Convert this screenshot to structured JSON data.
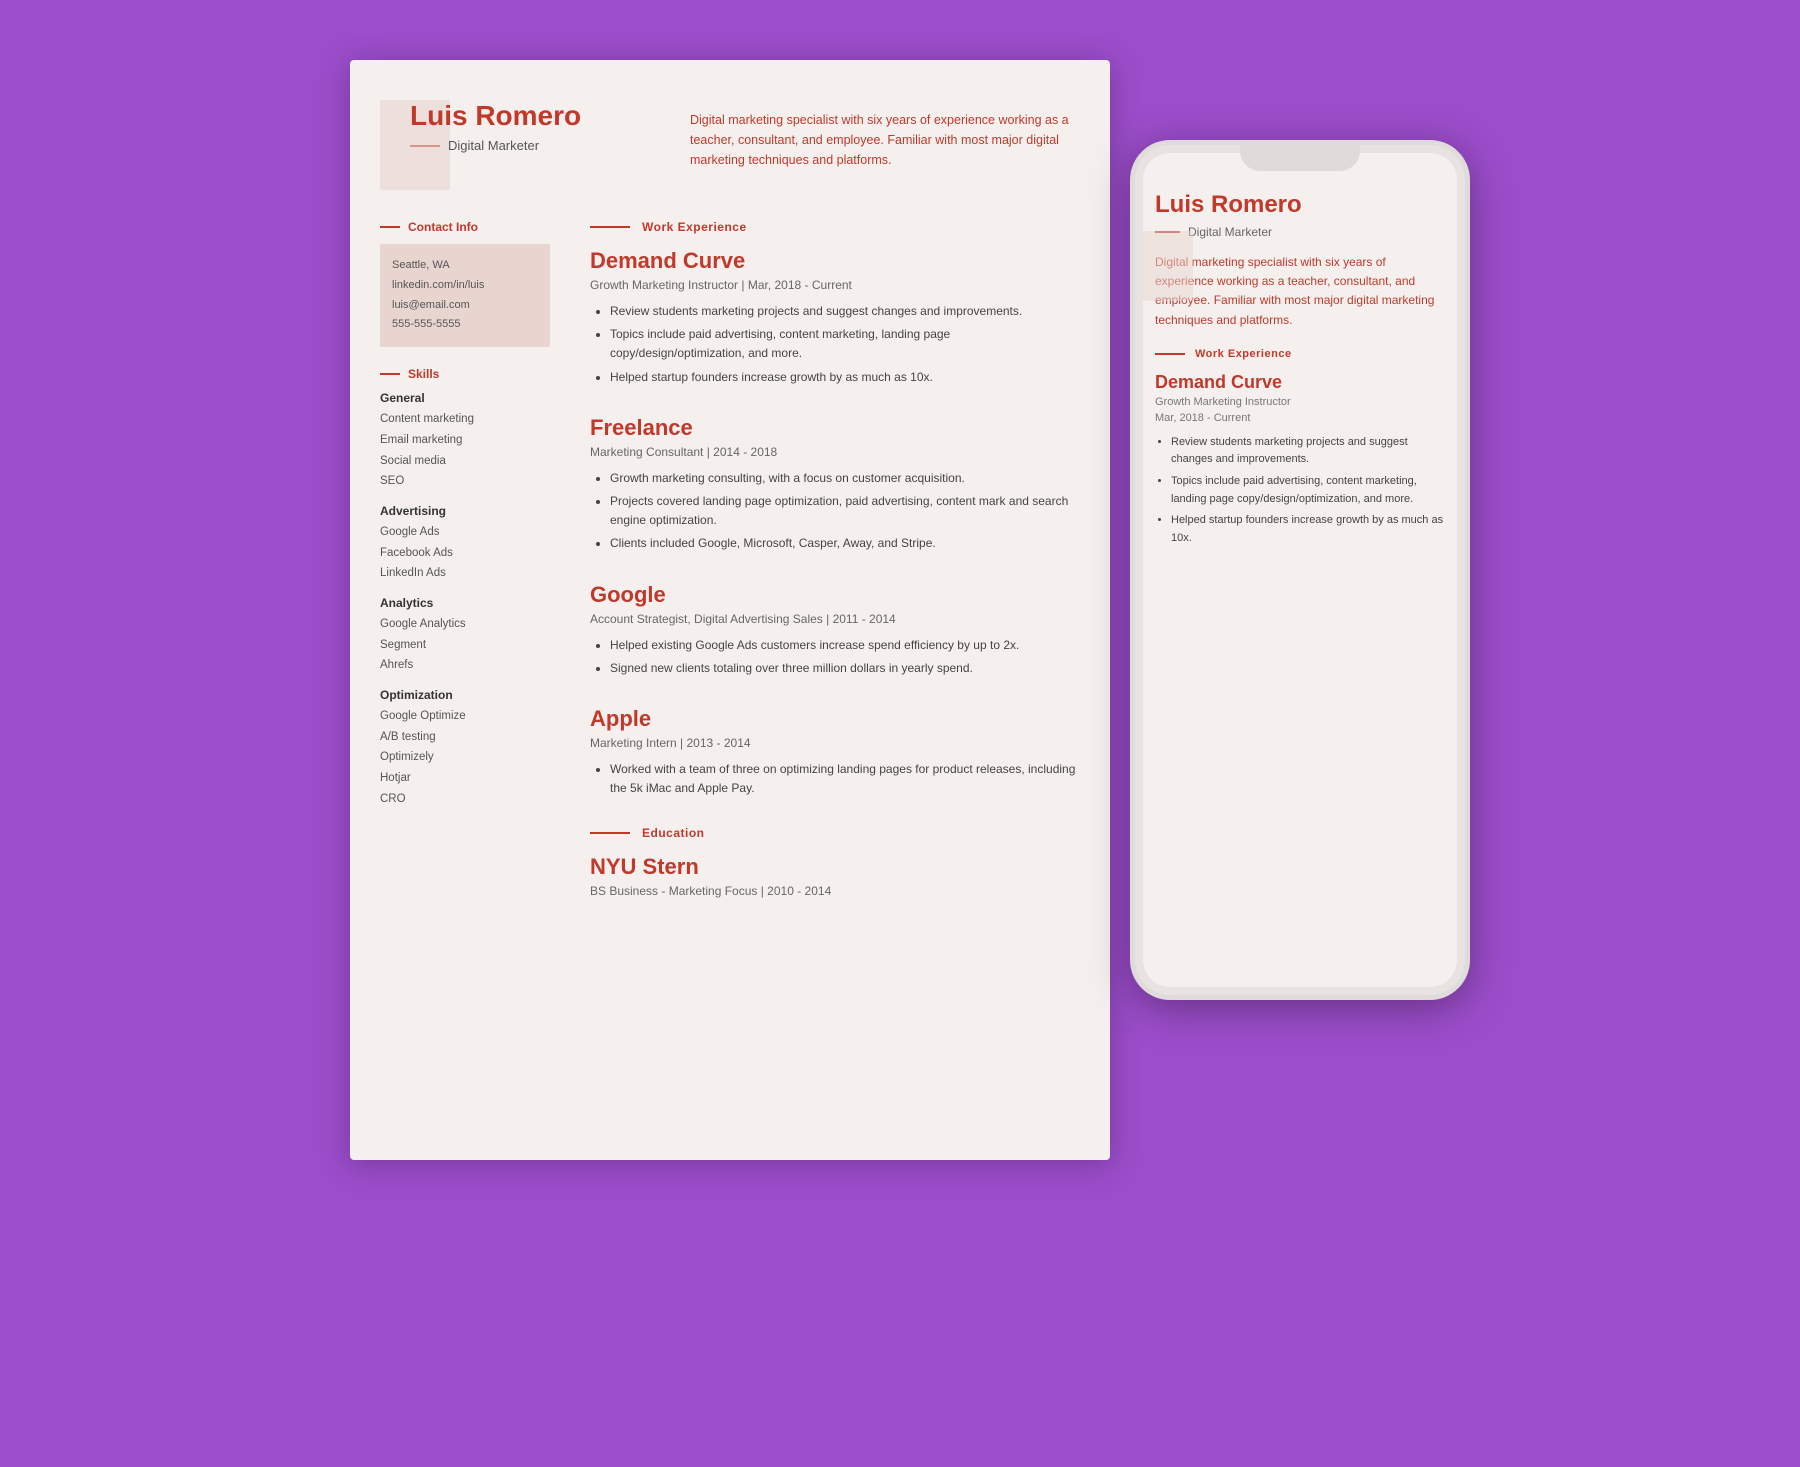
{
  "background": "#9b4dca",
  "accent": "#c0392b",
  "resume": {
    "name": "Luis Romero",
    "title": "Digital Marketer",
    "bio": "Digital marketing specialist with six years of experience working as a teacher, consultant, and employee. Familiar with most major digital marketing techniques and platforms.",
    "contact": {
      "label": "Contact Info",
      "items": [
        "Seattle, WA",
        "linkedin.com/in/luis",
        "luis@email.com",
        "555-555-5555"
      ]
    },
    "skills": {
      "label": "Skills",
      "categories": [
        {
          "title": "General",
          "items": [
            "Content marketing",
            "Email marketing",
            "Social media",
            "SEO"
          ]
        },
        {
          "title": "Advertising",
          "items": [
            "Google Ads",
            "Facebook Ads",
            "LinkedIn Ads"
          ]
        },
        {
          "title": "Analytics",
          "items": [
            "Google Analytics",
            "Segment",
            "Ahrefs"
          ]
        },
        {
          "title": "Optimization",
          "items": [
            "Google Optimize",
            "A/B testing",
            "Optimizely",
            "Hotjar",
            "CRO"
          ]
        }
      ]
    },
    "work_experience_label": "Work Experience",
    "jobs": [
      {
        "company": "Demand Curve",
        "role": "Growth Marketing Instructor | Mar, 2018 - Current",
        "bullets": [
          "Review students marketing projects and suggest changes and improvements.",
          "Topics include paid advertising, content marketing, landing page copy/design/optimization, and more.",
          "Helped startup founders increase growth by as much as 10x."
        ]
      },
      {
        "company": "Freelance",
        "role": "Marketing Consultant | 2014 - 2018",
        "bullets": [
          "Growth marketing consulting, with a focus on customer acquisition.",
          "Projects covered landing page optimization, paid advertising, content mark and search engine optimization.",
          "Clients included Google, Microsoft, Casper, Away, and Stripe."
        ]
      },
      {
        "company": "Google",
        "role": "Account Strategist, Digital Advertising Sales | 2011 - 2014",
        "bullets": [
          "Helped existing Google Ads customers increase spend efficiency by up to 2x.",
          "Signed new clients totaling over three million dollars in yearly spend."
        ]
      },
      {
        "company": "Apple",
        "role": "Marketing Intern | 2013 - 2014",
        "bullets": [
          "Worked with a team of three on optimizing landing pages for product releases, including the 5k iMac and Apple Pay."
        ]
      }
    ],
    "education_label": "Education",
    "education": [
      {
        "school": "NYU Stern",
        "detail": "BS Business - Marketing Focus | 2010 - 2014"
      }
    ]
  },
  "phone": {
    "name": "Luis Romero",
    "title": "Digital Marketer",
    "bio": "Digital marketing specialist with six years of experience working as a teacher, consultant, and employee. Familiar with most major digital marketing techniques and platforms.",
    "work_label": "Work Experience",
    "company": "Demand Curve",
    "role_line1": "Growth Marketing Instructor",
    "role_line2": "Mar, 2018 - Current",
    "bullets": [
      "Review students marketing projects and suggest changes and improvements.",
      "Topics include paid advertising, content marketing, landing page copy/design/optimization, and more.",
      "Helped startup founders increase growth by as much as 10x."
    ]
  }
}
